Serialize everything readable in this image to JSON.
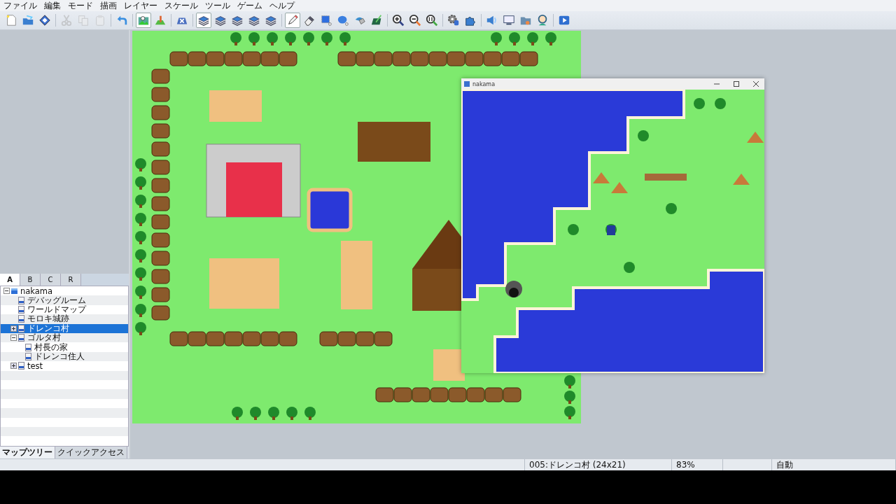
{
  "menu": [
    "ファイル",
    "編集",
    "モード",
    "描画",
    "レイヤー",
    "スケール",
    "ツール",
    "ゲーム",
    "ヘルプ"
  ],
  "toolbar": [
    [
      {
        "selected": false,
        "disabled": false
      },
      {
        "selected": false,
        "disabled": false
      },
      {
        "selected": false,
        "disabled": false
      }
    ],
    [
      {
        "selected": false,
        "disabled": true
      },
      {
        "selected": false,
        "disabled": true
      },
      {
        "selected": false,
        "disabled": true
      }
    ],
    [
      {
        "selected": false,
        "disabled": false
      }
    ],
    [
      {
        "selected": true,
        "disabled": false
      },
      {
        "selected": false,
        "disabled": false
      }
    ],
    [
      {
        "selected": false,
        "disabled": false
      }
    ],
    [
      {
        "selected": true,
        "disabled": false
      },
      {
        "selected": false,
        "disabled": false
      },
      {
        "selected": false,
        "disabled": false
      },
      {
        "selected": false,
        "disabled": false
      },
      {
        "selected": false,
        "disabled": false
      }
    ],
    [
      {
        "selected": true,
        "disabled": false
      },
      {
        "selected": false,
        "disabled": false
      },
      {
        "selected": false,
        "disabled": false
      },
      {
        "selected": false,
        "disabled": false
      },
      {
        "selected": false,
        "disabled": false
      },
      {
        "selected": false,
        "disabled": false
      }
    ],
    [
      {
        "selected": false,
        "disabled": false
      },
      {
        "selected": false,
        "disabled": false
      },
      {
        "selected": false,
        "disabled": false
      }
    ],
    [
      {
        "selected": false,
        "disabled": false
      },
      {
        "selected": false,
        "disabled": false
      }
    ],
    [
      {
        "selected": false,
        "disabled": false
      },
      {
        "selected": false,
        "disabled": false
      },
      {
        "selected": false,
        "disabled": false
      },
      {
        "selected": false,
        "disabled": false
      }
    ],
    [
      {
        "selected": false,
        "disabled": false
      }
    ]
  ],
  "panel_tabs": [
    {
      "label": "A",
      "selected": true
    },
    {
      "label": "B",
      "selected": false
    },
    {
      "label": "C",
      "selected": false
    },
    {
      "label": "R",
      "selected": false
    }
  ],
  "tree": [
    {
      "label": "nakama",
      "kind": "project",
      "expanded": true,
      "selected": false,
      "children": [
        {
          "label": "デバッグルーム",
          "kind": "map",
          "selected": false
        },
        {
          "label": "ワールドマップ",
          "kind": "map",
          "selected": false
        },
        {
          "label": "モロキ城跡",
          "kind": "map",
          "selected": false
        },
        {
          "label": "ドレンコ村",
          "kind": "map",
          "expanded": false,
          "selected": true
        },
        {
          "label": "ゴルタ村",
          "kind": "map",
          "expanded": true,
          "selected": false,
          "children": [
            {
              "label": "村長の家",
              "kind": "map",
              "selected": false
            },
            {
              "label": "ドレンコ住人",
              "kind": "map",
              "selected": false
            }
          ]
        },
        {
          "label": "test",
          "kind": "map",
          "expanded": false,
          "selected": false
        }
      ]
    }
  ],
  "bottom_tabs": [
    {
      "label": "マップツリー",
      "selected": true
    },
    {
      "label": "クイックアクセス",
      "selected": false
    }
  ],
  "game_window": {
    "title": "nakama"
  },
  "status_bar": {
    "map": "005:ドレンコ村 (24x21)",
    "zoom": "83%",
    "mode": "自動"
  }
}
